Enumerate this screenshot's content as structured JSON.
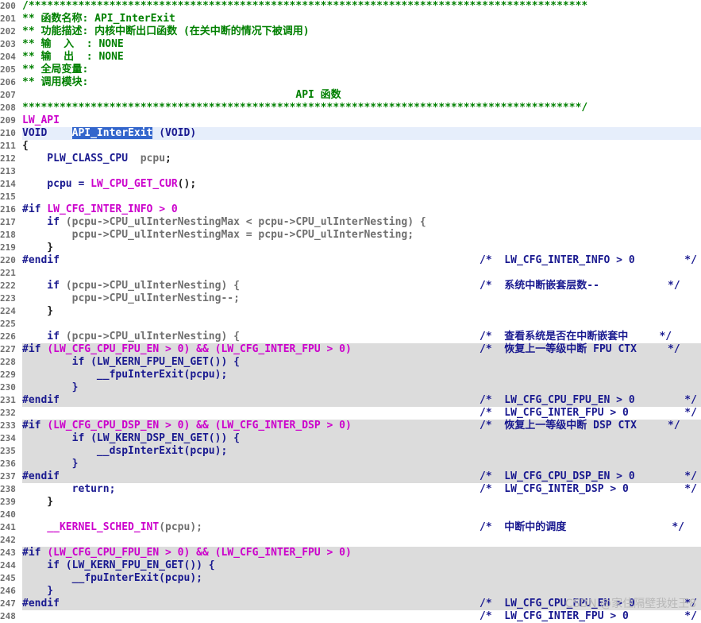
{
  "editor": {
    "lines": [
      {
        "num": "200",
        "bg": "",
        "segs": [
          {
            "t": "/******************************************************************************************",
            "c": "c-comment"
          }
        ],
        "cmt": ""
      },
      {
        "num": "201",
        "bg": "",
        "segs": [
          {
            "t": "** 函数名称: API_InterExit",
            "c": "c-comment"
          }
        ],
        "cmt": ""
      },
      {
        "num": "202",
        "bg": "",
        "segs": [
          {
            "t": "** 功能描述: 内核中断出口函数 (在关中断的情况下被调用)",
            "c": "c-comment"
          }
        ],
        "cmt": ""
      },
      {
        "num": "203",
        "bg": "",
        "segs": [
          {
            "t": "** 输  入  : NONE",
            "c": "c-comment"
          }
        ],
        "cmt": ""
      },
      {
        "num": "204",
        "bg": "",
        "segs": [
          {
            "t": "** 输  出  : NONE",
            "c": "c-comment"
          }
        ],
        "cmt": ""
      },
      {
        "num": "205",
        "bg": "",
        "segs": [
          {
            "t": "** 全局变量:",
            "c": "c-comment"
          }
        ],
        "cmt": ""
      },
      {
        "num": "206",
        "bg": "",
        "segs": [
          {
            "t": "** 调用模块:",
            "c": "c-comment"
          }
        ],
        "cmt": ""
      },
      {
        "num": "207",
        "bg": "",
        "segs": [
          {
            "t": "                                            API 函数",
            "c": "c-comment"
          }
        ],
        "cmt": ""
      },
      {
        "num": "208",
        "bg": "",
        "segs": [
          {
            "t": "******************************************************************************************/",
            "c": "c-comment"
          }
        ],
        "cmt": ""
      },
      {
        "num": "209",
        "bg": "",
        "segs": [
          {
            "t": "LW_API",
            "c": "c-pink"
          }
        ],
        "cmt": ""
      },
      {
        "num": "210",
        "bg": "current",
        "segs": [
          {
            "t": "VOID    ",
            "c": "c-blue"
          },
          {
            "t": "API_InterExit",
            "c": "sel"
          },
          {
            "t": " (VOID)",
            "c": "c-blue"
          }
        ],
        "cmt": ""
      },
      {
        "num": "211",
        "bg": "",
        "segs": [
          {
            "t": "{",
            "c": "c-black"
          }
        ],
        "cmt": ""
      },
      {
        "num": "212",
        "bg": "",
        "segs": [
          {
            "t": "    PLW_CLASS_CPU  ",
            "c": "c-blue"
          },
          {
            "t": "pcpu",
            "c": "c-gray"
          },
          {
            "t": ";",
            "c": "c-black"
          }
        ],
        "cmt": ""
      },
      {
        "num": "213",
        "bg": "",
        "segs": [],
        "cmt": ""
      },
      {
        "num": "214",
        "bg": "",
        "segs": [
          {
            "t": "    pcpu = ",
            "c": "c-blue"
          },
          {
            "t": "LW_CPU_GET_CUR",
            "c": "c-pink"
          },
          {
            "t": "();",
            "c": "c-black"
          }
        ],
        "cmt": ""
      },
      {
        "num": "215",
        "bg": "",
        "segs": [],
        "cmt": ""
      },
      {
        "num": "216",
        "bg": "",
        "segs": [
          {
            "t": "#if ",
            "c": "c-blue"
          },
          {
            "t": "LW_CFG_INTER_INFO > 0",
            "c": "c-pink"
          }
        ],
        "cmt": ""
      },
      {
        "num": "217",
        "bg": "",
        "segs": [
          {
            "t": "    if ",
            "c": "c-blue"
          },
          {
            "t": "(pcpu->CPU_ulInterNestingMax < pcpu->CPU_ulInterNesting) {",
            "c": "c-gray"
          }
        ],
        "cmt": ""
      },
      {
        "num": "218",
        "bg": "",
        "segs": [
          {
            "t": "        pcpu->CPU_ulInterNestingMax = pcpu->CPU_ulInterNesting;",
            "c": "c-gray"
          }
        ],
        "cmt": ""
      },
      {
        "num": "219",
        "bg": "",
        "segs": [
          {
            "t": "    }",
            "c": "c-black"
          }
        ],
        "cmt": ""
      },
      {
        "num": "220",
        "bg": "",
        "segs": [
          {
            "t": "#endif",
            "c": "c-blue"
          }
        ],
        "cmt": "/*  LW_CFG_INTER_INFO > 0        */"
      },
      {
        "num": "221",
        "bg": "",
        "segs": [],
        "cmt": ""
      },
      {
        "num": "222",
        "bg": "",
        "segs": [
          {
            "t": "    if ",
            "c": "c-blue"
          },
          {
            "t": "(pcpu->CPU_ulInterNesting) {",
            "c": "c-gray"
          }
        ],
        "cmt": "/*  系统中断嵌套层数--           */"
      },
      {
        "num": "223",
        "bg": "",
        "segs": [
          {
            "t": "        pcpu->CPU_ulInterNesting--;",
            "c": "c-gray"
          }
        ],
        "cmt": ""
      },
      {
        "num": "224",
        "bg": "",
        "segs": [
          {
            "t": "    }",
            "c": "c-black"
          }
        ],
        "cmt": ""
      },
      {
        "num": "225",
        "bg": "",
        "segs": [],
        "cmt": ""
      },
      {
        "num": "226",
        "bg": "",
        "segs": [
          {
            "t": "    if ",
            "c": "c-blue"
          },
          {
            "t": "(pcpu->CPU_ulInterNesting) {",
            "c": "c-gray"
          }
        ],
        "cmt": "/*  查看系统是否在中断嵌套中     */"
      },
      {
        "num": "227",
        "bg": "inactive",
        "segs": [
          {
            "t": "#if ",
            "c": "c-blue"
          },
          {
            "t": "(LW_CFG_CPU_FPU_EN > 0) && (LW_CFG_INTER_FPU > 0)",
            "c": "c-pink"
          }
        ],
        "cmt": "/*  恢复上一等级中断 FPU CTX     */"
      },
      {
        "num": "228",
        "bg": "inactive",
        "segs": [
          {
            "t": "        if (LW_KERN_FPU_EN_GET()) {",
            "c": "c-blue"
          }
        ],
        "cmt": ""
      },
      {
        "num": "229",
        "bg": "inactive",
        "segs": [
          {
            "t": "            __fpuInterExit(pcpu);",
            "c": "c-blue"
          }
        ],
        "cmt": ""
      },
      {
        "num": "230",
        "bg": "inactive",
        "segs": [
          {
            "t": "        }",
            "c": "c-blue"
          }
        ],
        "cmt": ""
      },
      {
        "num": "231",
        "bg": "inactive",
        "segs": [
          {
            "t": "#endif",
            "c": "c-blue"
          }
        ],
        "cmt": "/*  LW_CFG_CPU_FPU_EN > 0        */"
      },
      {
        "num": "232",
        "bg": "",
        "segs": [],
        "cmt": "/*  LW_CFG_INTER_FPU > 0         */"
      },
      {
        "num": "233",
        "bg": "inactive",
        "segs": [
          {
            "t": "#if ",
            "c": "c-blue"
          },
          {
            "t": "(LW_CFG_CPU_DSP_EN > 0) && (LW_CFG_INTER_DSP > 0)",
            "c": "c-pink"
          }
        ],
        "cmt": "/*  恢复上一等级中断 DSP CTX     */"
      },
      {
        "num": "234",
        "bg": "inactive",
        "segs": [
          {
            "t": "        if (LW_KERN_DSP_EN_GET()) {",
            "c": "c-blue"
          }
        ],
        "cmt": ""
      },
      {
        "num": "235",
        "bg": "inactive",
        "segs": [
          {
            "t": "            __dspInterExit(pcpu);",
            "c": "c-blue"
          }
        ],
        "cmt": ""
      },
      {
        "num": "236",
        "bg": "inactive",
        "segs": [
          {
            "t": "        }",
            "c": "c-blue"
          }
        ],
        "cmt": ""
      },
      {
        "num": "237",
        "bg": "inactive",
        "segs": [
          {
            "t": "#endif",
            "c": "c-blue"
          }
        ],
        "cmt": "/*  LW_CFG_CPU_DSP_EN > 0        */"
      },
      {
        "num": "238",
        "bg": "",
        "segs": [
          {
            "t": "        return;",
            "c": "c-blue"
          }
        ],
        "cmt": "/*  LW_CFG_INTER_DSP > 0         */"
      },
      {
        "num": "239",
        "bg": "",
        "segs": [
          {
            "t": "    }",
            "c": "c-black"
          }
        ],
        "cmt": ""
      },
      {
        "num": "240",
        "bg": "",
        "segs": [],
        "cmt": ""
      },
      {
        "num": "241",
        "bg": "",
        "segs": [
          {
            "t": "    __KERNEL_SCHED_INT",
            "c": "c-pink"
          },
          {
            "t": "(pcpu);",
            "c": "c-gray"
          }
        ],
        "cmt": "/*  中断中的调度                 */"
      },
      {
        "num": "242",
        "bg": "",
        "segs": [],
        "cmt": ""
      },
      {
        "num": "243",
        "bg": "inactive",
        "segs": [
          {
            "t": "#if ",
            "c": "c-blue"
          },
          {
            "t": "(LW_CFG_CPU_FPU_EN > 0) && (LW_CFG_INTER_FPU > 0)",
            "c": "c-pink"
          }
        ],
        "cmt": ""
      },
      {
        "num": "244",
        "bg": "inactive",
        "segs": [
          {
            "t": "    if (LW_KERN_FPU_EN_GET()) {",
            "c": "c-blue"
          }
        ],
        "cmt": ""
      },
      {
        "num": "245",
        "bg": "inactive",
        "segs": [
          {
            "t": "        __fpuInterExit(pcpu);",
            "c": "c-blue"
          }
        ],
        "cmt": ""
      },
      {
        "num": "246",
        "bg": "inactive",
        "segs": [
          {
            "t": "    }",
            "c": "c-blue"
          }
        ],
        "cmt": ""
      },
      {
        "num": "247",
        "bg": "inactive",
        "segs": [
          {
            "t": "#endif",
            "c": "c-blue"
          }
        ],
        "cmt": "/*  LW_CFG_CPU_FPU_EN > 0        */"
      },
      {
        "num": "248",
        "bg": "",
        "segs": [],
        "cmt": "/*  LW_CFG_INTER_FPU > 0         */"
      }
    ]
  },
  "watermark": "CSDN @家住隔壁我姓王8"
}
